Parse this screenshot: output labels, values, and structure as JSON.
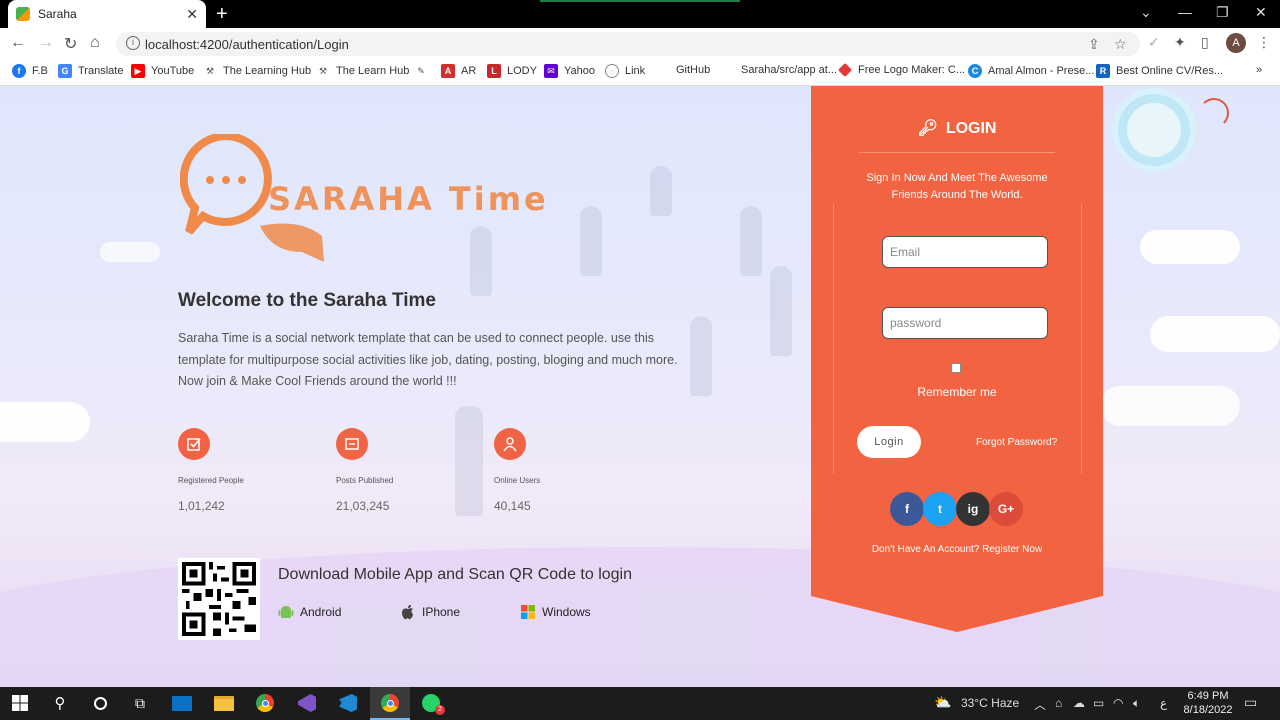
{
  "browser": {
    "tab_title": "Saraha",
    "url": "localhost:4200/authentication/Login",
    "bookmarks": [
      {
        "label": "F.B",
        "icon": "facebook-icon",
        "color": "#1877f2"
      },
      {
        "label": "Translate",
        "icon": "translate-icon",
        "color": "#4285f4"
      },
      {
        "label": "YouTube",
        "icon": "youtube-icon",
        "color": "#ff0000"
      },
      {
        "label": "The Learning Hub",
        "icon": "hub-icon",
        "color": "#555555"
      },
      {
        "label": "The Learn Hub",
        "icon": "hub-icon",
        "color": "#555555"
      },
      {
        "label": "",
        "icon": "pen-icon",
        "color": "#555555"
      },
      {
        "label": "AR",
        "icon": "ar-icon",
        "color": "#d32f2f"
      },
      {
        "label": "LODY",
        "icon": "lody-icon",
        "color": "#c62828"
      },
      {
        "label": "Yahoo",
        "icon": "yahoo-icon",
        "color": "#6001d2"
      },
      {
        "label": "Link",
        "icon": "globe-icon",
        "color": "#757575"
      },
      {
        "label": "GitHub",
        "icon": "",
        "color": ""
      },
      {
        "label": "Saraha/src/app at...",
        "icon": "",
        "color": ""
      },
      {
        "label": "Free Logo Maker: C...",
        "icon": "logo-maker-icon",
        "color": "#e53935"
      },
      {
        "label": "Amal Almon - Prese...",
        "icon": "canva-icon",
        "color": "#1e88e5"
      },
      {
        "label": "Best Online CV/Res...",
        "icon": "resume-icon",
        "color": "#1565c0"
      }
    ],
    "more_bookmarks": "»",
    "profile_initial": "A"
  },
  "hero": {
    "logo_text": "SARAHA Time",
    "welcome_title": "Welcome to the Saraha Time",
    "description": "Saraha Time is a social network template that can be used to connect people. use this template for multipurpose social activities like job, dating, posting, bloging and much more. Now join & Make Cool Friends around the world !!!",
    "stats": [
      {
        "label": "Registered People",
        "value": "1,01,242",
        "icon": "checkbox-icon"
      },
      {
        "label": "Posts Published",
        "value": "21,03,245",
        "icon": "post-icon"
      },
      {
        "label": "Online Users",
        "value": "40,145",
        "icon": "user-icon"
      }
    ],
    "download_title": "Download Mobile App and Scan QR Code to login",
    "apps": [
      {
        "label": "Android",
        "icon": "android-icon"
      },
      {
        "label": "IPhone",
        "icon": "apple-icon"
      },
      {
        "label": "Windows",
        "icon": "windows-icon"
      }
    ]
  },
  "login": {
    "title": "LOGIN",
    "subtitle": "Sign In Now And Meet The Awesome Friends Around The World.",
    "email_placeholder": "Email",
    "password_placeholder": "password",
    "remember_label": "Remember me",
    "login_button": "Login",
    "forgot_link": "Forgot Password?",
    "social": [
      {
        "label": "f",
        "icon": "facebook-icon",
        "color": "#3b5998"
      },
      {
        "label": "t",
        "icon": "twitter-icon",
        "color": "#1da1f2"
      },
      {
        "label": "ig",
        "icon": "instagram-icon",
        "color": "#333333"
      },
      {
        "label": "G+",
        "icon": "google-plus-icon",
        "color": "#dd4b39"
      }
    ],
    "register_link": "Don't Have An Account? Register Now",
    "accent_color": "#f26341"
  },
  "taskbar": {
    "weather": "33°C  Haze",
    "time": "6:49 PM",
    "date": "8/18/2022",
    "lang": "ع"
  }
}
